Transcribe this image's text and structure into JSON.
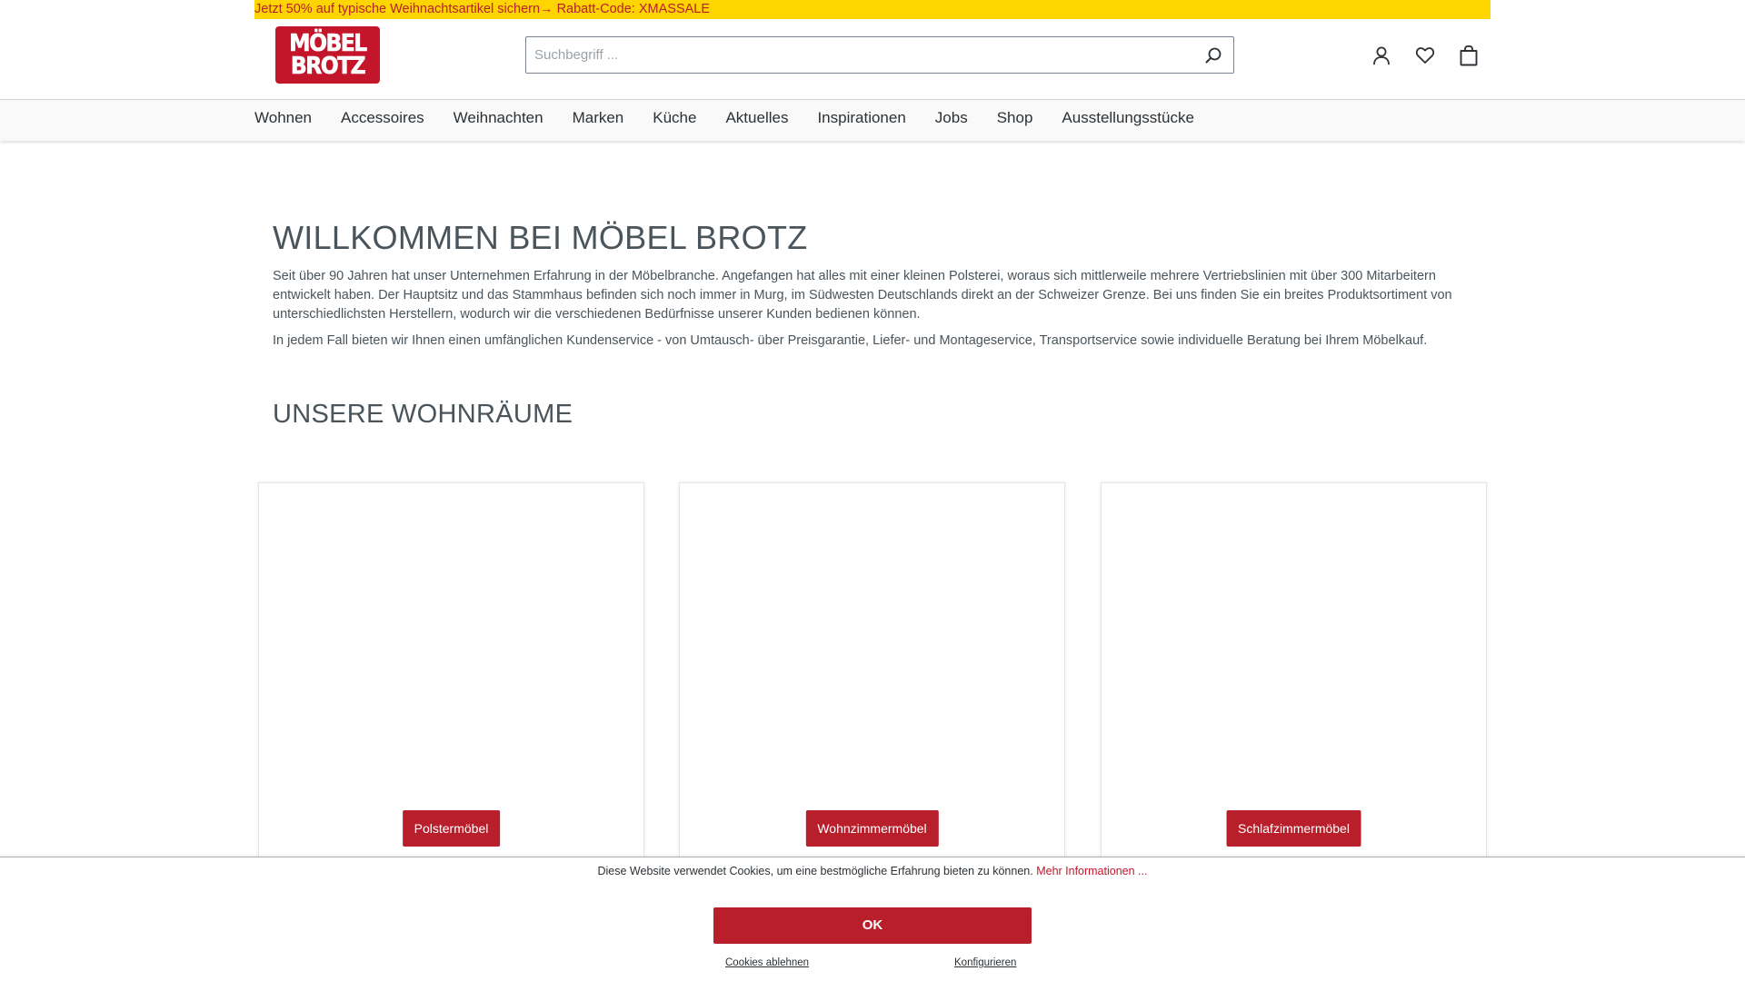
{
  "promo": {
    "text": "Jetzt 50% auf typische Weihnachtsartikel sichern→ Rabatt-Code: XMASSALE"
  },
  "header": {
    "logo": {
      "line1": "MÖBEL",
      "line2": "BROTZ"
    },
    "search": {
      "placeholder": "Suchbegriff ...",
      "value": ""
    },
    "actions": [
      {
        "icon": "user-icon"
      },
      {
        "icon": "heart-icon"
      },
      {
        "icon": "shopping-bag-icon"
      }
    ]
  },
  "nav": {
    "items": [
      "Wohnen",
      "Accessoires",
      "Weihnachten",
      "Marken",
      "Küche",
      "Aktuelles",
      "Inspirationen",
      "Jobs",
      "Shop",
      "Ausstellungsstücke"
    ]
  },
  "main": {
    "title": "WILLKOMMEN BEI MÖBEL BROTZ",
    "intro1": "Seit über 90 Jahren hat unser Unternehmen Erfahrung in der Möbelbranche. Angefangen hat alles mit einer kleinen Polsterei, woraus sich mittlerweile mehrere Vertriebslinien mit über 300 Mitarbeitern entwickelt haben. Der Hauptsitz und das Stammhaus befinden sich noch immer in Murg, im Südwesten Deutschlands direkt an der Schweizer Grenze. Bei uns finden Sie ein breites Produktsortiment von unterschiedlichsten Herstellern, wodurch wir die verschiedenen Bedürfnisse unserer Kunden bedienen können.",
    "intro2": "In jedem Fall bieten wir Ihnen einen umfänglichen Kundenservice - von Umtausch- über Preisgarantie, Liefer- und Montageservice, Transportservice sowie individuelle Beratung bei Ihrem Möbelkauf.",
    "rooms_title": "UNSERE WOHNRÄUME",
    "rooms": [
      {
        "label": "Polstermöbel"
      },
      {
        "label": "Wohnzimmermöbel"
      },
      {
        "label": "Schlafzimmermöbel"
      }
    ]
  },
  "cookie": {
    "text": "Diese Website verwendet Cookies, um eine bestmögliche Erfahrung bieten zu können.",
    "more": "Mehr Informationen ...",
    "ok": "OK",
    "decline": "Cookies ablehnen",
    "configure": "Konfigurieren"
  },
  "colors": {
    "brand_red": "#b81f2b",
    "promo_yellow": "#ffd500",
    "text": "#4a545b"
  }
}
